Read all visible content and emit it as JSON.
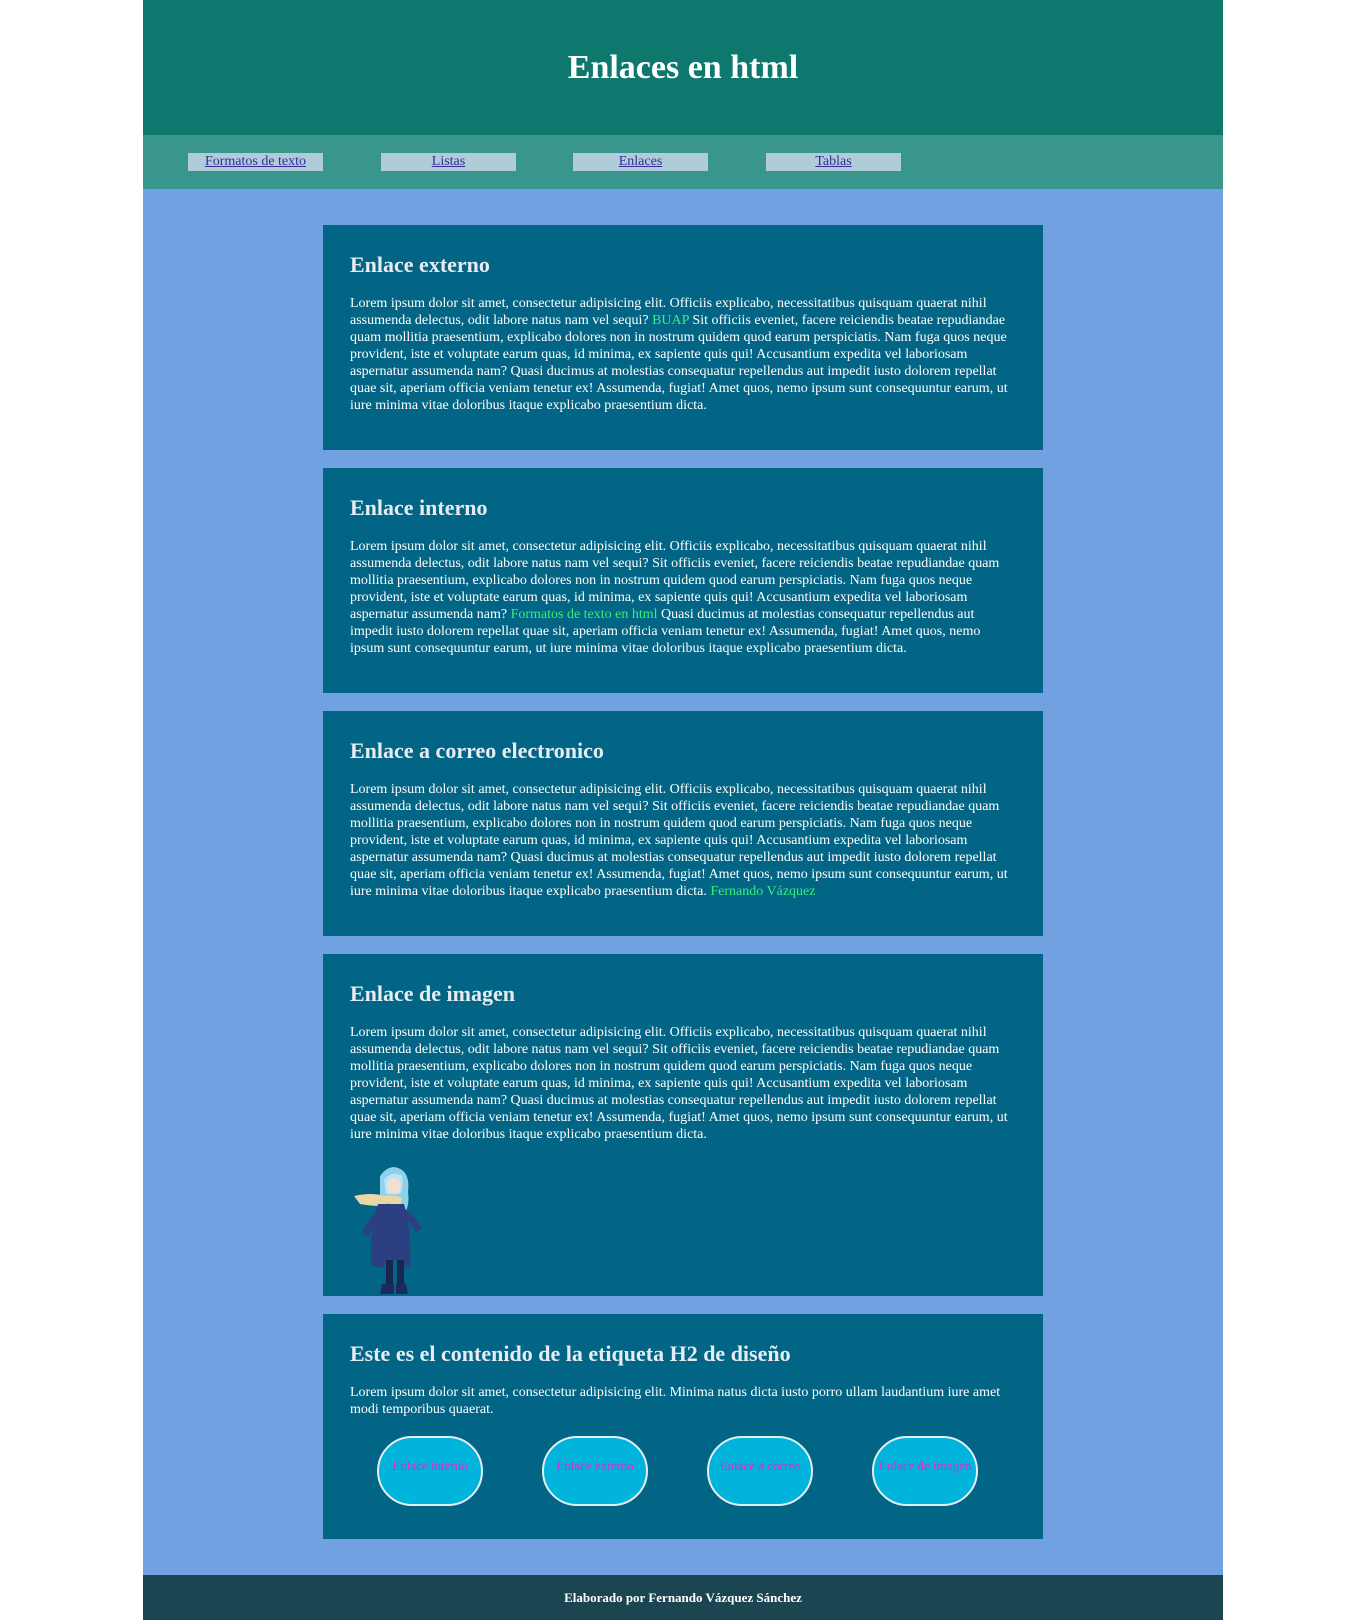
{
  "header": {
    "title": "Enlaces en html"
  },
  "nav": {
    "items": [
      "Formatos de texto",
      "Listas",
      "Enlaces",
      "Tablas"
    ]
  },
  "sections": {
    "externo": {
      "title": "Enlace externo",
      "text_before": "Lorem ipsum dolor sit amet, consectetur adipisicing elit. Officiis explicabo, necessitatibus quisquam quaerat nihil assumenda delectus, odit labore natus nam vel sequi? ",
      "link": "BUAP",
      "text_after": " Sit officiis eveniet, facere reiciendis beatae repudiandae quam mollitia praesentium, explicabo dolores non in nostrum quidem quod earum perspiciatis. Nam fuga quos neque provident, iste et voluptate earum quas, id minima, ex sapiente quis qui! Accusantium expedita vel laboriosam aspernatur assumenda nam? Quasi ducimus at molestias consequatur repellendus aut impedit iusto dolorem repellat quae sit, aperiam officia veniam tenetur ex! Assumenda, fugiat! Amet quos, nemo ipsum sunt consequuntur earum, ut iure minima vitae doloribus itaque explicabo praesentium dicta."
    },
    "interno": {
      "title": "Enlace interno",
      "text_before": "Lorem ipsum dolor sit amet, consectetur adipisicing elit. Officiis explicabo, necessitatibus quisquam quaerat nihil assumenda delectus, odit labore natus nam vel sequi? Sit officiis eveniet, facere reiciendis beatae repudiandae quam mollitia praesentium, explicabo dolores non in nostrum quidem quod earum perspiciatis. Nam fuga quos neque provident, iste et voluptate earum quas, id minima, ex sapiente quis qui! Accusantium expedita vel laboriosam aspernatur assumenda nam? ",
      "link": "Formatos de texto en html",
      "text_after": " Quasi ducimus at molestias consequatur repellendus aut impedit iusto dolorem repellat quae sit, aperiam officia veniam tenetur ex! Assumenda, fugiat! Amet quos, nemo ipsum sunt consequuntur earum, ut iure minima vitae doloribus itaque explicabo praesentium dicta."
    },
    "correo": {
      "title": "Enlace a correo electronico",
      "text_before": "Lorem ipsum dolor sit amet, consectetur adipisicing elit. Officiis explicabo, necessitatibus quisquam quaerat nihil assumenda delectus, odit labore natus nam vel sequi? Sit officiis eveniet, facere reiciendis beatae repudiandae quam mollitia praesentium, explicabo dolores non in nostrum quidem quod earum perspiciatis. Nam fuga quos neque provident, iste et voluptate earum quas, id minima, ex sapiente quis qui! Accusantium expedita vel laboriosam aspernatur assumenda nam? Quasi ducimus at molestias consequatur repellendus aut impedit iusto dolorem repellat quae sit, aperiam officia veniam tenetur ex! Assumenda, fugiat! Amet quos, nemo ipsum sunt consequuntur earum, ut iure minima vitae doloribus itaque explicabo praesentium dicta. ",
      "link": "Fernando Vázquez"
    },
    "imagen": {
      "title": "Enlace de imagen",
      "text": "Lorem ipsum dolor sit amet, consectetur adipisicing elit. Officiis explicabo, necessitatibus quisquam quaerat nihil assumenda delectus, odit labore natus nam vel sequi? Sit officiis eveniet, facere reiciendis beatae repudiandae quam mollitia praesentium, explicabo dolores non in nostrum quidem quod earum perspiciatis. Nam fuga quos neque provident, iste et voluptate earum quas, id minima, ex sapiente quis qui! Accusantium expedita vel laboriosam aspernatur assumenda nam? Quasi ducimus at molestias consequatur repellendus aut impedit iusto dolorem repellat quae sit, aperiam officia veniam tenetur ex! Assumenda, fugiat! Amet quos, nemo ipsum sunt consequuntur earum, ut iure minima vitae doloribus itaque explicabo praesentium dicta."
    },
    "diseno": {
      "title": "Este es el contenido de la etiqueta H2 de diseño",
      "text": "Lorem ipsum dolor sit amet, consectetur adipisicing elit. Minima natus dicta iusto porro ullam laudantium iure amet modi temporibus quaerat.",
      "buttons": [
        "Enlace interno",
        "Enlace externo",
        "Enlace a correo",
        "Enlace de imagen"
      ]
    }
  },
  "footer": {
    "text": "Elaborado por Fernando Vázquez Sánchez"
  },
  "colors": {
    "page_bg": "#71a1e1",
    "header_bg": "#0e786e",
    "nav_bg": "#39968c",
    "card_bg": "#036585",
    "link_green": "#36ef7a",
    "pill_bg": "#00b4db",
    "pill_text": "#d52fd2",
    "footer_bg": "#1c4552"
  }
}
